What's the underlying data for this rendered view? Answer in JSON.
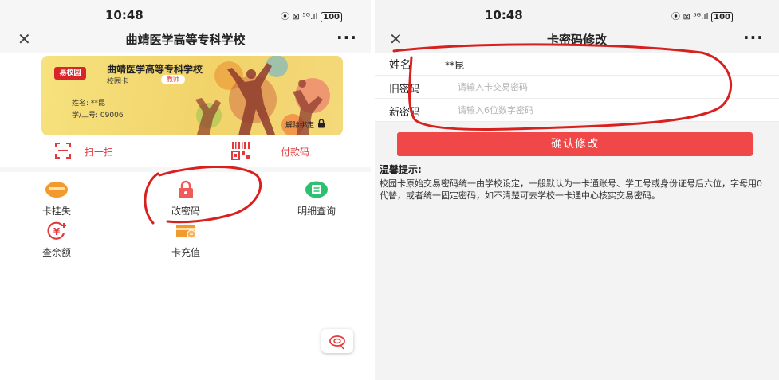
{
  "left": {
    "status": {
      "time": "10:48",
      "signal_text": "⦿ ⊠ ⁵ᴳ.ıl",
      "battery": "100"
    },
    "header": {
      "title": "曲靖医学高等专科学校",
      "more": "···"
    },
    "card": {
      "logo": "易校园",
      "school": "曲靖医学高等专科学校",
      "type": "校园卡",
      "role": "教师",
      "name": "姓名: **昆",
      "id": "学/工号: 09006",
      "unbind": "解除绑定"
    },
    "quick_actions": {
      "scan": "扫一扫",
      "pay_code": "付款码"
    },
    "functions": [
      {
        "label": "卡挂失",
        "icon": "card-loss-icon",
        "color": "#f29a2e"
      },
      {
        "label": "改密码",
        "icon": "lock-icon",
        "color": "#f05a5a"
      },
      {
        "label": "明细查询",
        "icon": "detail-icon",
        "color": "#2fbf71"
      },
      {
        "label": "查余额",
        "icon": "balance-icon",
        "color": "#e4393c"
      },
      {
        "label": "卡充值",
        "icon": "recharge-icon",
        "color": "#f29a2e"
      }
    ]
  },
  "right": {
    "status": {
      "time": "10:48",
      "signal_text": "⦿ ⊠ ⁵ᴳ.ıl",
      "battery": "100"
    },
    "header": {
      "title": "卡密码修改",
      "more": "···"
    },
    "form": {
      "name_label": "姓名",
      "name_value": "**昆",
      "old_label": "旧密码",
      "old_placeholder": "请输入卡交易密码",
      "new_label": "新密码",
      "new_placeholder": "请输入6位数字密码"
    },
    "confirm_label": "确认修改",
    "tips": {
      "title": "温馨提示:",
      "body": "校园卡原始交易密码统一由学校设定，一般默认为一卡通账号、学工号或身份证号后六位，字母用0代替，或者统一固定密码，如不清楚可去学校一卡通中心核实交易密码。"
    }
  },
  "colors": {
    "accent_red": "#f04848",
    "card_yellow": "#f2d36a",
    "annotation_red": "#d8201e"
  }
}
